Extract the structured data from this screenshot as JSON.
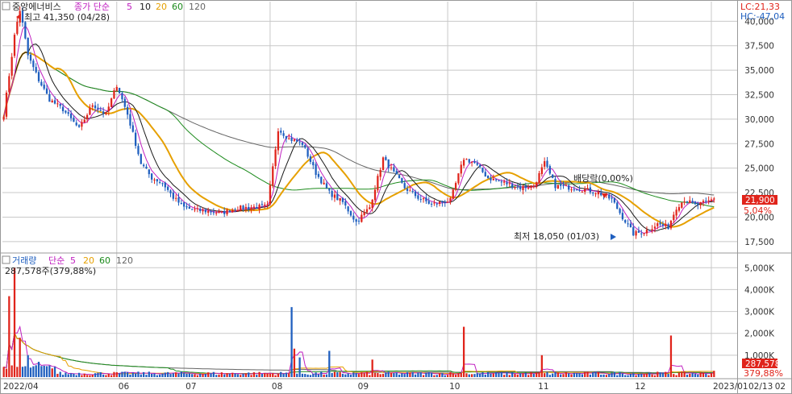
{
  "price_legend": {
    "name": "중앙에너비스",
    "ma_label": "종가 단순",
    "periods": [
      "5",
      "10",
      "20",
      "60",
      "120"
    ]
  },
  "volume_legend": {
    "name": "거래량",
    "ma_label": "단순",
    "periods": [
      "5",
      "20",
      "60",
      "120"
    ],
    "current": "287,578주(379,88%)"
  },
  "indicators": {
    "lc": "LC:21,33",
    "hc": "HC:-47,04"
  },
  "annotations": {
    "high": "최고 41,350 (04/28)",
    "low": "최저 18,050 (01/03)",
    "dividend": "배당락(0,00%)"
  },
  "badges": {
    "price": "21,900",
    "change": "5,04%",
    "volume": "287,578",
    "volume_ratio": "379,88%"
  },
  "colors": {
    "up": "#e0241b",
    "down": "#1f5fbf",
    "ma5": "#c020c0",
    "ma10": "#1a1a1a",
    "ma20": "#e6a000",
    "ma60": "#1b8a1b",
    "ma120": "#666666",
    "grid": "#c8c8c8"
  },
  "chart_data": [
    {
      "type": "candlestick",
      "series_name": "중앙에너비스",
      "ylim": [
        16500,
        42000
      ],
      "y_ticks": [
        "17,500",
        "20,000",
        "22,500",
        "25,000",
        "27,500",
        "30,000",
        "32,500",
        "35,000",
        "37,500",
        "40,000"
      ],
      "x_labels": [
        "2022/04",
        "06",
        "07",
        "08",
        "09",
        "10",
        "11",
        "12",
        "2023/01",
        "02",
        "02/13"
      ],
      "last_close": 21900,
      "high": 41350,
      "low": 18050,
      "anchors": [
        [
          0,
          30500
        ],
        [
          4,
          38500
        ],
        [
          6,
          41350
        ],
        [
          9,
          36500
        ],
        [
          13,
          34000
        ],
        [
          17,
          32000
        ],
        [
          22,
          31000
        ],
        [
          28,
          29000
        ],
        [
          33,
          31500
        ],
        [
          38,
          30500
        ],
        [
          42,
          33500
        ],
        [
          46,
          30500
        ],
        [
          51,
          25500
        ],
        [
          55,
          24000
        ],
        [
          59,
          23500
        ],
        [
          63,
          22000
        ],
        [
          67,
          21000
        ],
        [
          71,
          20700
        ],
        [
          76,
          20600
        ],
        [
          81,
          20400
        ],
        [
          86,
          20900
        ],
        [
          92,
          21000
        ],
        [
          98,
          21100
        ],
        [
          102,
          29000
        ],
        [
          106,
          28000
        ],
        [
          111,
          27500
        ],
        [
          116,
          24500
        ],
        [
          121,
          22500
        ],
        [
          126,
          21500
        ],
        [
          131,
          19500
        ],
        [
          136,
          21000
        ],
        [
          141,
          26000
        ],
        [
          145,
          24500
        ],
        [
          149,
          23000
        ],
        [
          154,
          22000
        ],
        [
          159,
          21300
        ],
        [
          166,
          21700
        ],
        [
          171,
          26000
        ],
        [
          175,
          25500
        ],
        [
          180,
          24000
        ],
        [
          186,
          23500
        ],
        [
          192,
          23000
        ],
        [
          197,
          23200
        ],
        [
          201,
          25500
        ],
        [
          205,
          23200
        ],
        [
          211,
          23000
        ],
        [
          216,
          22800
        ],
        [
          221,
          22500
        ],
        [
          226,
          21800
        ],
        [
          230,
          20000
        ],
        [
          234,
          18300
        ],
        [
          238,
          18500
        ],
        [
          243,
          19300
        ],
        [
          247,
          19000
        ],
        [
          250,
          21000
        ],
        [
          253,
          21800
        ],
        [
          257,
          21200
        ],
        [
          261,
          21500
        ],
        [
          264,
          21900
        ]
      ]
    },
    {
      "type": "bar",
      "series_name": "거래량",
      "ylim": [
        0,
        5600000
      ],
      "y_ticks": [
        "1,000K",
        "2,000K",
        "3,000K",
        "4,000K",
        "5,000K"
      ],
      "last_value": 287578,
      "spikes": [
        [
          2,
          3700000
        ],
        [
          4,
          5000000
        ],
        [
          6,
          1800000
        ],
        [
          9,
          1000000
        ],
        [
          13,
          700000
        ],
        [
          107,
          3200000
        ],
        [
          108,
          1300000
        ],
        [
          110,
          900000
        ],
        [
          121,
          1200000
        ],
        [
          137,
          800000
        ],
        [
          171,
          2300000
        ],
        [
          200,
          1000000
        ],
        [
          248,
          1900000
        ],
        [
          264,
          287578
        ]
      ]
    }
  ]
}
